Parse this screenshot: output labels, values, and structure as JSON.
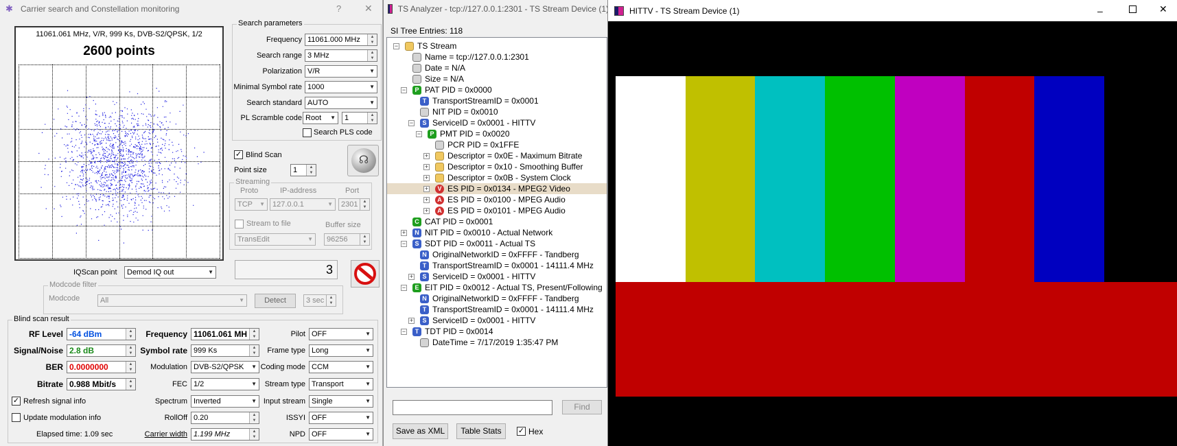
{
  "carrier": {
    "title": "Carrier search and Constellation monitoring",
    "help": "?",
    "close": "✕",
    "const_info": "11061.061 MHz, V/R, 999 Ks, DVB-S2/QPSK, 1/2",
    "const_points": "2600 points",
    "search": {
      "legend": "Search parameters",
      "freq_label": "Frequency",
      "freq": "11061.000 MHz",
      "range_label": "Search range",
      "range": "3 MHz",
      "pol_label": "Polarization",
      "pol": "V/R",
      "msr_label": "Minimal Symbol rate",
      "msr": "1000",
      "std_label": "Search standard",
      "std": "AUTO",
      "pls_label": "PL Scramble code",
      "pls_mode": "Root",
      "pls_val": "1",
      "pls_search": "Search PLS code"
    },
    "blind_scan": "Blind Scan",
    "point_size_label": "Point size",
    "point_size": "1",
    "streaming": {
      "legend": "Streaming",
      "proto_label": "Proto",
      "ip_label": "IP-address",
      "port_label": "Port",
      "proto": "TCP",
      "ip": "127.0.0.1",
      "port": "2301",
      "to_file": "Stream to file",
      "buffer_label": "Buffer size",
      "transedit": "TransEdit",
      "buffer": "96256"
    },
    "iq_label": "IQScan point",
    "iq_value": "Demod IQ out",
    "counter": "3",
    "modcode": {
      "legend": "Modcode filter",
      "label": "Modcode",
      "value": "All",
      "detect": "Detect",
      "time": "3 sec"
    },
    "result": {
      "legend": "Blind scan result",
      "rf_label": "RF Level",
      "rf": "-64 dBm",
      "sn_label": "Signal/Noise",
      "sn": "2.8 dB",
      "ber_label": "BER",
      "ber": "0.0000000",
      "bitrate_label": "Bitrate",
      "bitrate": "0.988 Mbit/s",
      "freq_label": "Frequency",
      "freq": "11061.061 MH",
      "sr_label": "Symbol rate",
      "sr": "999 Ks",
      "mod_label": "Modulation",
      "mod": "DVB-S2/QPSK",
      "fec_label": "FEC",
      "fec": "1/2",
      "spec_label": "Spectrum",
      "spec": "Inverted",
      "roll_label": "RollOff",
      "roll": "0.20",
      "cw_label": "Carrier width",
      "cw": "1.199 MHz",
      "pilot_label": "Pilot",
      "pilot": "OFF",
      "frame_label": "Frame type",
      "frame": "Long",
      "coding_label": "Coding mode",
      "coding": "CCM",
      "stype_label": "Stream type",
      "stype": "Transport",
      "istream_label": "Input stream",
      "istream": "Single",
      "issyi_label": "ISSYI",
      "issyi": "OFF",
      "npd_label": "NPD",
      "npd": "OFF"
    },
    "refresh": "Refresh signal info",
    "update_mod": "Update modulation info",
    "elapsed": "Elapsed time: 1.09 sec",
    "colors": {
      "point": "#1a1ae0",
      "rf": "#0050e0",
      "ber": "#e00000"
    }
  },
  "ts": {
    "title": "TS Analyzer - tcp://127.0.0.1:2301 - TS Stream Device (1)",
    "entries": "SI Tree Entries: 118",
    "tree": [
      {
        "t": "TS Stream",
        "i": "folder",
        "d": 0,
        "e": "-"
      },
      {
        "t": "Name = tcp://127.0.0.1:2301",
        "i": "gray",
        "d": 1
      },
      {
        "t": "Date = N/A",
        "i": "gray",
        "d": 1
      },
      {
        "t": "Size = N/A",
        "i": "gray",
        "d": 1
      },
      {
        "t": "PAT PID = 0x0000",
        "i": "P",
        "d": 1,
        "e": "-"
      },
      {
        "t": "TransportStreamID = 0x0001",
        "i": "T",
        "d": 2
      },
      {
        "t": "NIT PID = 0x0010",
        "i": "gray",
        "d": 2
      },
      {
        "t": "ServiceID = 0x0001 - HITTV",
        "i": "S",
        "d": 2,
        "e": "-"
      },
      {
        "t": "PMT PID = 0x0020",
        "i": "P",
        "d": 3,
        "e": "-"
      },
      {
        "t": "PCR PID = 0x1FFE",
        "i": "gray",
        "d": 4
      },
      {
        "t": "Descriptor = 0x0E - Maximum Bitrate",
        "i": "folder",
        "d": 4,
        "e": "+"
      },
      {
        "t": "Descriptor = 0x10 - Smoothing Buffer",
        "i": "folder",
        "d": 4,
        "e": "+"
      },
      {
        "t": "Descriptor = 0x0B - System Clock",
        "i": "folder",
        "d": 4,
        "e": "+"
      },
      {
        "t": "ES PID = 0x0134 - MPEG2 Video",
        "i": "V",
        "d": 4,
        "e": "+",
        "sel": true
      },
      {
        "t": "ES PID = 0x0100 - MPEG Audio",
        "i": "A",
        "d": 4,
        "e": "+"
      },
      {
        "t": "ES PID = 0x0101 - MPEG Audio",
        "i": "A",
        "d": 4,
        "e": "+"
      },
      {
        "t": "CAT PID = 0x0001",
        "i": "C",
        "d": 1
      },
      {
        "t": "NIT PID = 0x0010 - Actual Network",
        "i": "N",
        "d": 1,
        "e": "+"
      },
      {
        "t": "SDT PID = 0x0011 - Actual TS",
        "i": "S",
        "d": 1,
        "e": "-"
      },
      {
        "t": "OriginalNetworkID = 0xFFFF - Tandberg",
        "i": "N",
        "d": 2
      },
      {
        "t": "TransportStreamID = 0x0001 - 14111.4 MHz",
        "i": "T",
        "d": 2
      },
      {
        "t": "ServiceID = 0x0001 - HITTV",
        "i": "S",
        "d": 2,
        "e": "+"
      },
      {
        "t": "EIT PID = 0x0012 - Actual TS, Present/Following",
        "i": "E",
        "d": 1,
        "e": "-"
      },
      {
        "t": "OriginalNetworkID = 0xFFFF - Tandberg",
        "i": "N",
        "d": 2
      },
      {
        "t": "TransportStreamID = 0x0001 - 14111.4 MHz",
        "i": "T",
        "d": 2
      },
      {
        "t": "ServiceID = 0x0001 - HITTV",
        "i": "S",
        "d": 2,
        "e": "+"
      },
      {
        "t": "TDT PID = 0x0014",
        "i": "T",
        "d": 1,
        "e": "-"
      },
      {
        "t": "DateTime = 7/17/2019 1:35:47 PM",
        "i": "gray",
        "d": 2
      }
    ],
    "find": "Find",
    "save_xml": "Save as XML",
    "table_stats": "Table Stats",
    "hex": "Hex",
    "icon_colors": {
      "P": "#1e9e1e",
      "T": "#3a5fc8",
      "S": "#3a5fc8",
      "V": "#d03030",
      "A": "#d03030",
      "C": "#1e9e1e",
      "N": "#3a5fc8",
      "E": "#1e9e1e"
    }
  },
  "video": {
    "title": "HITTV - TS Stream Device (1)",
    "bars": [
      "#ffffff",
      "#c0c000",
      "#00c0c0",
      "#00c000",
      "#c000c0",
      "#c00000",
      "#0000c0"
    ],
    "bottom": "#c00000"
  }
}
